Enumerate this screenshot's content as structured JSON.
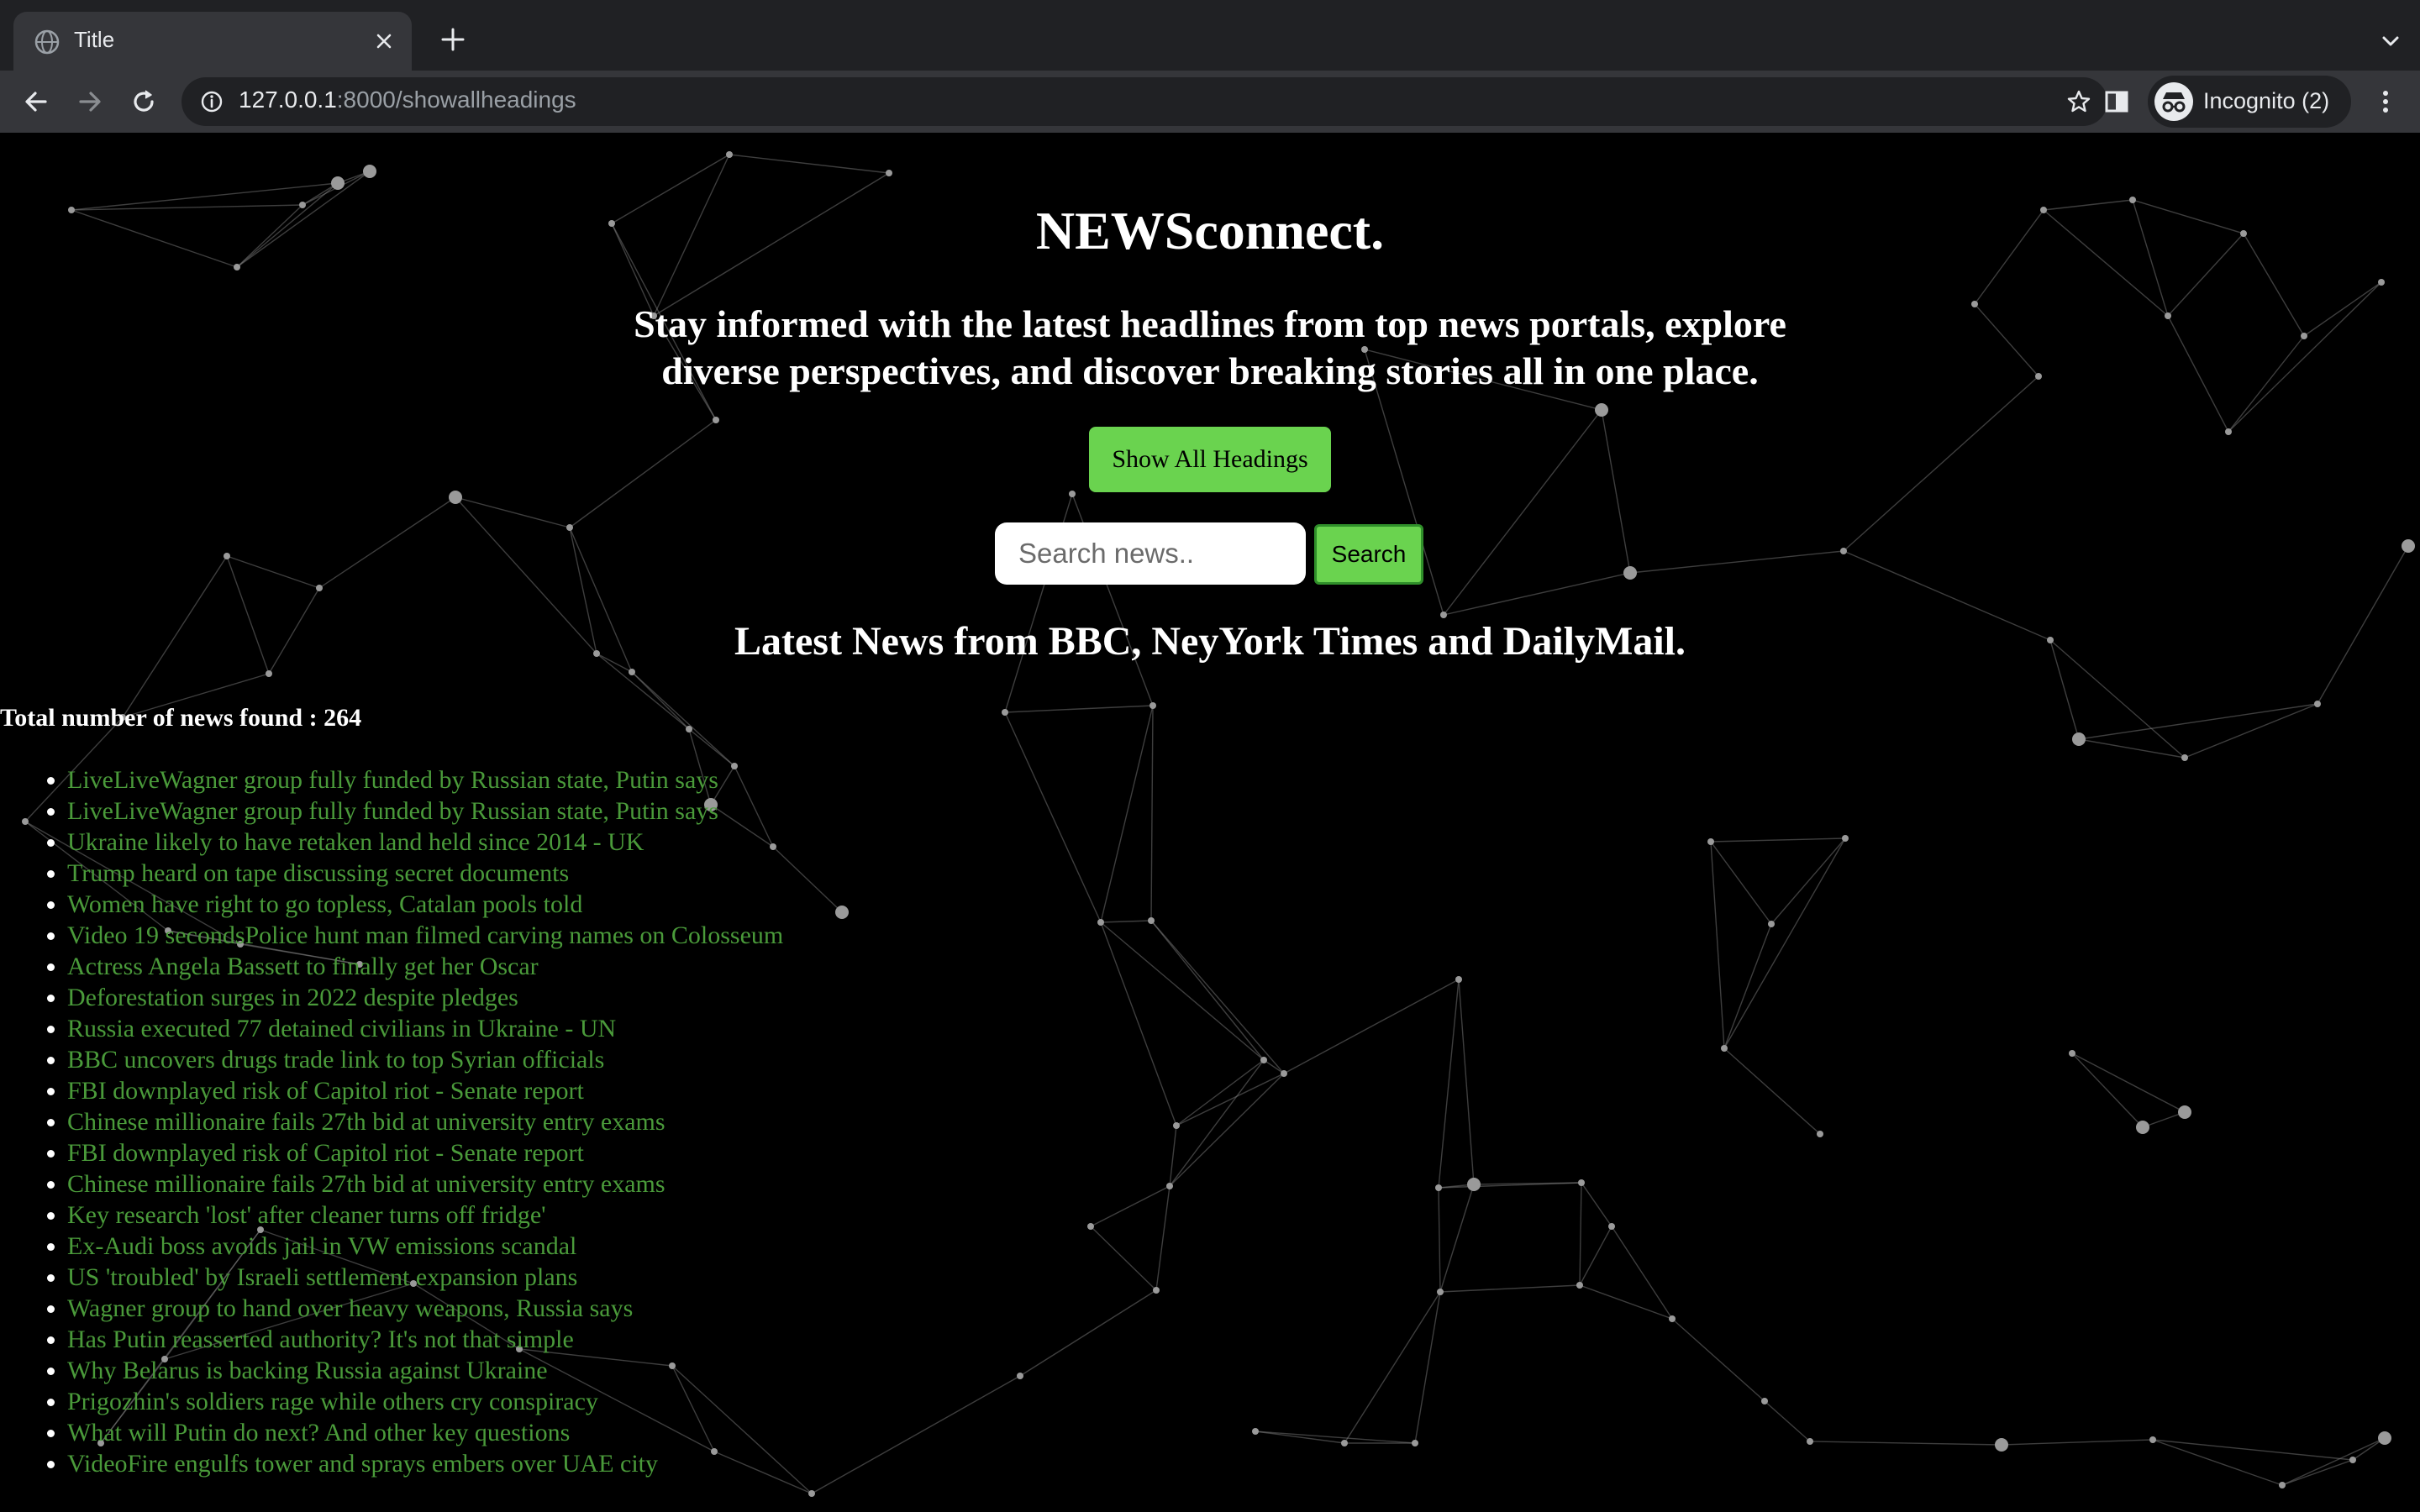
{
  "browser": {
    "tab_title": "Title",
    "url_host": "127.0.0.1",
    "url_rest": ":8000/showallheadings",
    "profile_label": "Incognito (2)"
  },
  "icons": {
    "tab_favicon": "globe-icon",
    "tab_close": "close-icon",
    "new_tab": "plus-icon",
    "tab_menu": "chevron-down-icon",
    "back": "back-arrow-icon",
    "forward": "forward-arrow-icon",
    "reload": "reload-icon",
    "site_info": "info-icon",
    "bookmark": "star-icon",
    "side_panel": "side-panel-icon",
    "incognito": "incognito-icon",
    "menu": "kebab-menu-icon"
  },
  "colors": {
    "accent_green": "#6ad34f",
    "link_green": "#4a9a3a",
    "background": "#000000",
    "chrome_dark": "#202124",
    "chrome_mid": "#35363a"
  },
  "page": {
    "title": "NEWSconnect.",
    "tagline": "Stay informed with the latest headlines from top news portals, explore diverse perspectives, and discover breaking stories all in one place.",
    "show_all_label": "Show All Headings",
    "search_placeholder": "Search news..",
    "search_value": "",
    "search_button_label": "Search",
    "section_heading": "Latest News from BBC, NeyYork Times and DailyMail.",
    "total_label": "Total number of news found : 264"
  },
  "news": [
    "LiveLiveWagner group fully funded by Russian state, Putin says",
    "LiveLiveWagner group fully funded by Russian state, Putin says",
    "Ukraine likely to have retaken land held since 2014 - UK",
    "Trump heard on tape discussing secret documents",
    "Women have right to go topless, Catalan pools told",
    "Video 19 secondsPolice hunt man filmed carving names on Colosseum",
    "Actress Angela Bassett to finally get her Oscar",
    "Deforestation surges in 2022 despite pledges",
    "Russia executed 77 detained civilians in Ukraine - UN",
    "BBC uncovers drugs trade link to top Syrian officials",
    "FBI downplayed risk of Capitol riot - Senate report",
    "Chinese millionaire fails 27th bid at university entry exams",
    "FBI downplayed risk of Capitol riot - Senate report",
    "Chinese millionaire fails 27th bid at university entry exams",
    "Key research 'lost' after cleaner turns off fridge'",
    "Ex-Audi boss avoids jail in VW emissions scandal",
    "US 'troubled' by Israeli settlement expansion plans",
    "Wagner group to hand over heavy weapons, Russia says",
    "Has Putin reasserted authority? It's not that simple",
    "Why Belarus is backing Russia against Ukraine",
    "Prigozhin's soldiers rage while others cry conspiracy",
    "What will Putin do next? And other key questions",
    "VideoFire engulfs tower and sprays embers over UAE city"
  ]
}
